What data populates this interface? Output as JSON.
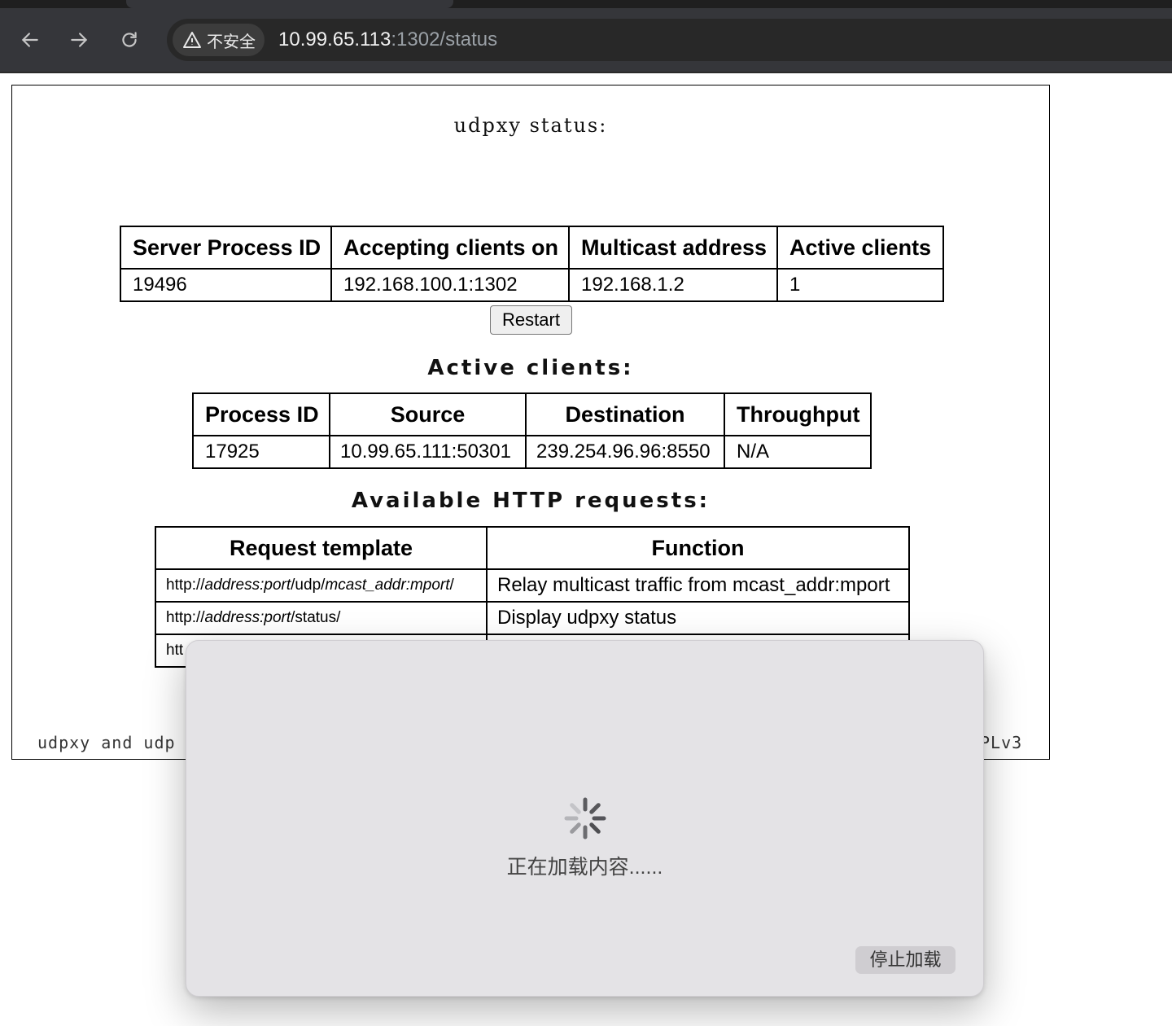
{
  "browser": {
    "security_label": "不安全",
    "url_host": "10.99.65.113",
    "url_path": ":1302/status"
  },
  "page": {
    "title": "udpxy status:",
    "server_table": {
      "headers": [
        "Server Process ID",
        "Accepting clients on",
        "Multicast address",
        "Active clients"
      ],
      "row": [
        "19496",
        "192.168.100.1:1302",
        "192.168.1.2",
        "1"
      ]
    },
    "restart_label": "Restart",
    "clients_heading": "Active clients:",
    "clients_table": {
      "headers": [
        "Process ID",
        "Source",
        "Destination",
        "Throughput"
      ],
      "rows": [
        [
          "17925",
          "10.99.65.111:50301",
          "239.254.96.96:8550",
          "N/A"
        ]
      ]
    },
    "requests_heading": "Available HTTP requests:",
    "requests_table": {
      "headers": [
        "Request template",
        "Function"
      ],
      "row1": {
        "pre": "http://",
        "italic1": "address:port",
        "mid": "/udp/",
        "italic2": "mcast_addr:mport",
        "post": "/",
        "function": "Relay multicast traffic from mcast_addr:mport"
      },
      "row2": {
        "pre": "http://",
        "italic1": "address:port",
        "mid": "/status/",
        "function": "Display udpxy status"
      },
      "row3_partial": "htt"
    },
    "footer_left_partial": "udpxy and udp",
    "footer_right_partial": "PLv3"
  },
  "overlay": {
    "loading_text": "正在加载内容......",
    "stop_label": "停止加载"
  }
}
